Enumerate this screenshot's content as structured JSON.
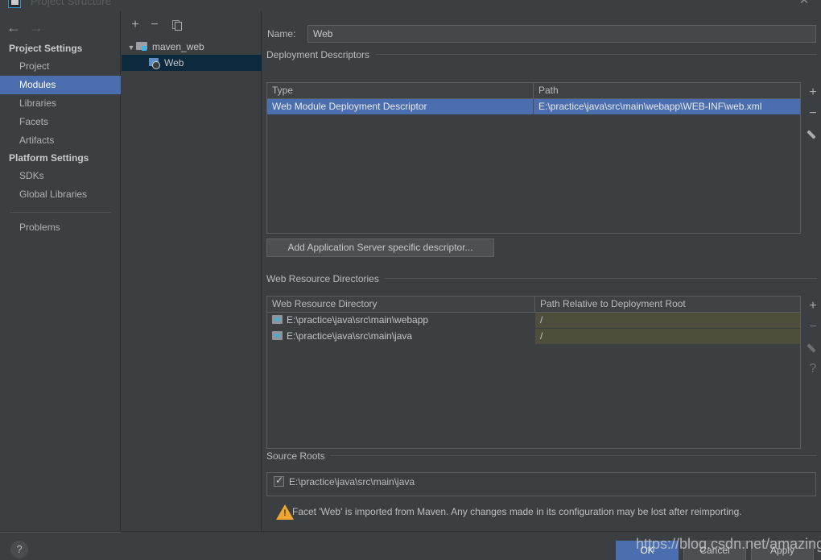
{
  "window": {
    "title": "Project Structure",
    "app_icon": "idea-icon",
    "close_label": "✕"
  },
  "sidebar": {
    "nav_back": "←",
    "nav_forward": "→",
    "groups": [
      {
        "label": "Project Settings",
        "items": [
          {
            "label": "Project",
            "selected": false
          },
          {
            "label": "Modules",
            "selected": true
          },
          {
            "label": "Libraries",
            "selected": false
          },
          {
            "label": "Facets",
            "selected": false
          },
          {
            "label": "Artifacts",
            "selected": false
          }
        ]
      },
      {
        "label": "Platform Settings",
        "items": [
          {
            "label": "SDKs",
            "selected": false
          },
          {
            "label": "Global Libraries",
            "selected": false
          }
        ]
      }
    ],
    "problems_label": "Problems"
  },
  "tree_panel": {
    "toolbar": {
      "add": "+",
      "remove": "−",
      "copy": "copy-icon"
    },
    "nodes": [
      {
        "label": "maven_web",
        "type": "module",
        "expanded": true,
        "selected": false
      },
      {
        "label": "Web",
        "type": "facet",
        "selected": true
      }
    ]
  },
  "main": {
    "name_field": {
      "label": "Name:",
      "value": "Web"
    },
    "deployment_descriptors": {
      "title": "Deployment Descriptors",
      "columns": [
        "Type",
        "Path"
      ],
      "rows": [
        {
          "type": "Web Module Deployment Descriptor",
          "path": "E:\\practice\\java\\src\\main\\webapp\\WEB-INF\\web.xml",
          "selected": true
        }
      ],
      "toolbar": [
        {
          "name": "add-descriptor-button",
          "glyph": "+",
          "enabled": true
        },
        {
          "name": "remove-descriptor-button",
          "glyph": "−",
          "enabled": true
        },
        {
          "name": "edit-descriptor-button",
          "glyph": "pencil",
          "enabled": true
        }
      ],
      "add_server_descriptor_button": "Add Application Server specific descriptor..."
    },
    "web_resource_directories": {
      "title": "Web Resource Directories",
      "columns": [
        "Web Resource Directory",
        "Path Relative to Deployment Root"
      ],
      "rows": [
        {
          "directory": "E:\\practice\\java\\src\\main\\webapp",
          "relative_path": "/"
        },
        {
          "directory": "E:\\practice\\java\\src\\main\\java",
          "relative_path": "/"
        }
      ],
      "toolbar": [
        {
          "name": "add-resource-dir-button",
          "glyph": "+",
          "enabled": true
        },
        {
          "name": "remove-resource-dir-button",
          "glyph": "−",
          "enabled": false
        },
        {
          "name": "edit-resource-dir-button",
          "glyph": "pencil",
          "enabled": false
        },
        {
          "name": "help-resource-dir-button",
          "glyph": "?",
          "enabled": true
        }
      ]
    },
    "source_roots": {
      "title": "Source Roots",
      "rows": [
        {
          "label": "E:\\practice\\java\\src\\main\\java",
          "checked": true
        }
      ]
    },
    "warning": {
      "icon": "warning-triangle-icon",
      "text": "Facet 'Web' is imported from Maven. Any changes made in its configuration may be lost after reimporting."
    }
  },
  "footer": {
    "help": "?",
    "ok": "OK",
    "cancel": "Cancel",
    "apply": "Apply"
  },
  "watermark": {
    "text": "https://blog.csdn.net/amazinga"
  },
  "colors": {
    "background": "#3c3f41",
    "selection_blue": "#4b6eaf",
    "tree_selection": "#0d293e",
    "olive_cell": "#4f4d3c",
    "warning_orange": "#f0a732",
    "accent_cyan": "#35b3e0"
  }
}
